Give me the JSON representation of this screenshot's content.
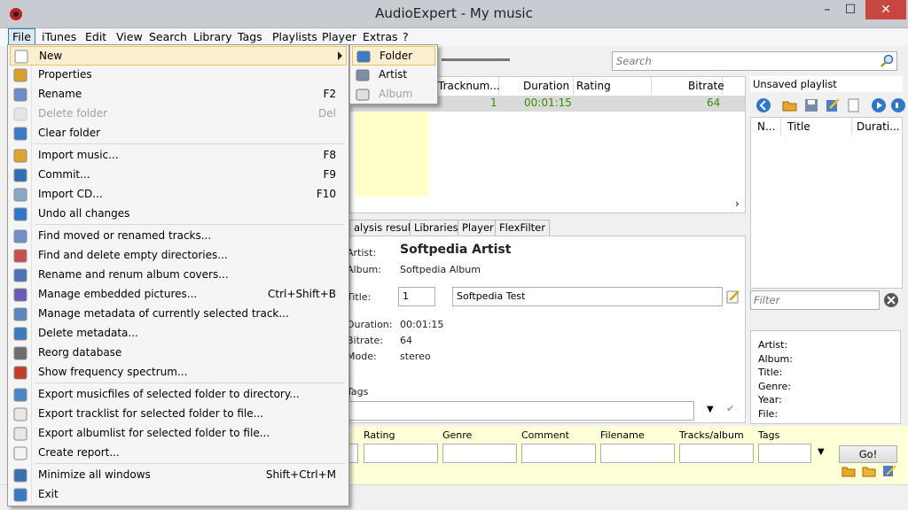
{
  "window": {
    "title": "AudioExpert - My music",
    "minimize": "–",
    "maximize": "☐",
    "close": "✕"
  },
  "menubar": [
    "File",
    "iTunes",
    "Edit",
    "View",
    "Search",
    "Library",
    "Tags",
    "Playlists",
    "Player",
    "Extras",
    "?"
  ],
  "search": {
    "placeholder": "Search"
  },
  "tracklist": {
    "columns": [
      "Tracknum...",
      "Duration",
      "Rating",
      "Bitrate"
    ],
    "row": {
      "tracknum": "1",
      "duration": "00:01:15",
      "bitrate": "64"
    }
  },
  "tabs": [
    "alysis result",
    "Libraries",
    "Player",
    "FlexFilter"
  ],
  "details": {
    "artist_label": "Artist:",
    "artist": "Softpedia Artist",
    "album_label": "Album:",
    "album": "Softpedia Album",
    "title_label": "Title:",
    "track_no": "1",
    "title": "Softpedia Test",
    "duration_label": "Duration:",
    "duration": "00:01:15",
    "bitrate_label": "Bitrate:",
    "bitrate": "64",
    "mode_label": "Mode:",
    "mode": "stereo",
    "tags_label": "Tags"
  },
  "playlist": {
    "name": "Unsaved playlist",
    "columns": [
      "N...",
      "Title",
      "Durati..."
    ],
    "filter_placeholder": "Filter",
    "info": [
      "Artist:",
      "Album:",
      "Title:",
      "Genre:",
      "Year:",
      "File:"
    ]
  },
  "filterbar": {
    "fields": [
      "Rating",
      "Genre",
      "Comment",
      "Filename",
      "Tracks/album",
      "Tags"
    ],
    "go": "Go!"
  },
  "file_menu": {
    "items": [
      {
        "label": "New",
        "shortcut": "",
        "icon": "blank-page-icon",
        "submenu": true,
        "highlighted": true
      },
      {
        "label": "Properties",
        "shortcut": "",
        "icon": "properties-icon"
      },
      {
        "label": "Rename",
        "shortcut": "F2",
        "icon": "rename-icon"
      },
      {
        "label": "Delete folder",
        "shortcut": "Del",
        "icon": "delete-folder-icon",
        "disabled": true
      },
      {
        "label": "Clear folder",
        "shortcut": "",
        "icon": "clear-folder-icon"
      },
      {
        "label": "Import music...",
        "shortcut": "F8",
        "icon": "import-icon"
      },
      {
        "label": "Commit...",
        "shortcut": "F9",
        "icon": "commit-icon"
      },
      {
        "label": "Import CD...",
        "shortcut": "F10",
        "icon": "cd-icon"
      },
      {
        "label": "Undo all changes",
        "shortcut": "",
        "icon": "undo-icon"
      },
      {
        "label": "Find moved or renamed tracks...",
        "shortcut": "",
        "icon": "find-moved-icon"
      },
      {
        "label": "Find and delete empty directories...",
        "shortcut": "",
        "icon": "find-empty-icon"
      },
      {
        "label": "Rename and renum album covers...",
        "shortcut": "",
        "icon": "cover-rename-icon"
      },
      {
        "label": "Manage embedded pictures...",
        "shortcut": "Ctrl+Shift+B",
        "icon": "pictures-icon"
      },
      {
        "label": "Manage metadata of currently selected track...",
        "shortcut": "",
        "icon": "metadata-icon"
      },
      {
        "label": "Delete metadata...",
        "shortcut": "",
        "icon": "delete-metadata-icon"
      },
      {
        "label": "Reorg database",
        "shortcut": "",
        "icon": "database-icon"
      },
      {
        "label": "Show frequency spectrum...",
        "shortcut": "",
        "icon": "spectrum-icon"
      },
      {
        "label": "Export musicfiles of selected folder to directory...",
        "shortcut": "",
        "icon": "export-folder-icon"
      },
      {
        "label": "Export tracklist for selected folder to file...",
        "shortcut": "",
        "icon": "export-list-icon"
      },
      {
        "label": "Export albumlist for selected folder to file...",
        "shortcut": "",
        "icon": "export-album-icon"
      },
      {
        "label": "Create report...",
        "shortcut": "",
        "icon": "report-icon"
      },
      {
        "label": "Minimize all windows",
        "shortcut": "Shift+Ctrl+M",
        "icon": "minimize-icon"
      },
      {
        "label": "Exit",
        "shortcut": "",
        "icon": "exit-icon"
      }
    ]
  },
  "new_submenu": {
    "items": [
      {
        "label": "Folder",
        "icon": "folder-icon",
        "highlighted": true
      },
      {
        "label": "Artist",
        "icon": "artist-icon"
      },
      {
        "label": "Album",
        "icon": "album-icon",
        "disabled": true
      }
    ]
  }
}
